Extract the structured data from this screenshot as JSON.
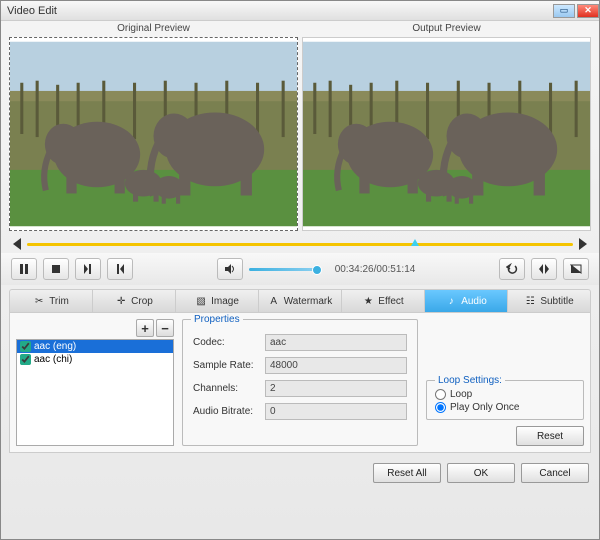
{
  "window": {
    "title": "Video Edit"
  },
  "previews": {
    "original": "Original Preview",
    "output": "Output Preview"
  },
  "timecode": "00:34:26/00:51:14",
  "tabs": [
    {
      "icon": "✂",
      "label": "Trim"
    },
    {
      "icon": "✛",
      "label": "Crop"
    },
    {
      "icon": "▧",
      "label": "Image"
    },
    {
      "icon": "A",
      "label": "Watermark"
    },
    {
      "icon": "★",
      "label": "Effect"
    },
    {
      "icon": "♪",
      "label": "Audio"
    },
    {
      "icon": "☷",
      "label": "Subtitle"
    }
  ],
  "addremove": {
    "add": "+",
    "remove": "−"
  },
  "tracks": [
    {
      "label": "aac (eng)",
      "checked": true,
      "selected": true
    },
    {
      "label": "aac (chi)",
      "checked": true,
      "selected": false
    }
  ],
  "properties": {
    "legend": "Properties",
    "codec_label": "Codec:",
    "codec": "aac",
    "samplerate_label": "Sample Rate:",
    "samplerate": "48000",
    "channels_label": "Channels:",
    "channels": "2",
    "bitrate_label": "Audio Bitrate:",
    "bitrate": "0"
  },
  "loop": {
    "legend": "Loop Settings:",
    "loop_label": "Loop",
    "playonce_label": "Play Only Once",
    "selected": "playonce"
  },
  "buttons": {
    "reset": "Reset",
    "resetall": "Reset All",
    "ok": "OK",
    "cancel": "Cancel"
  }
}
